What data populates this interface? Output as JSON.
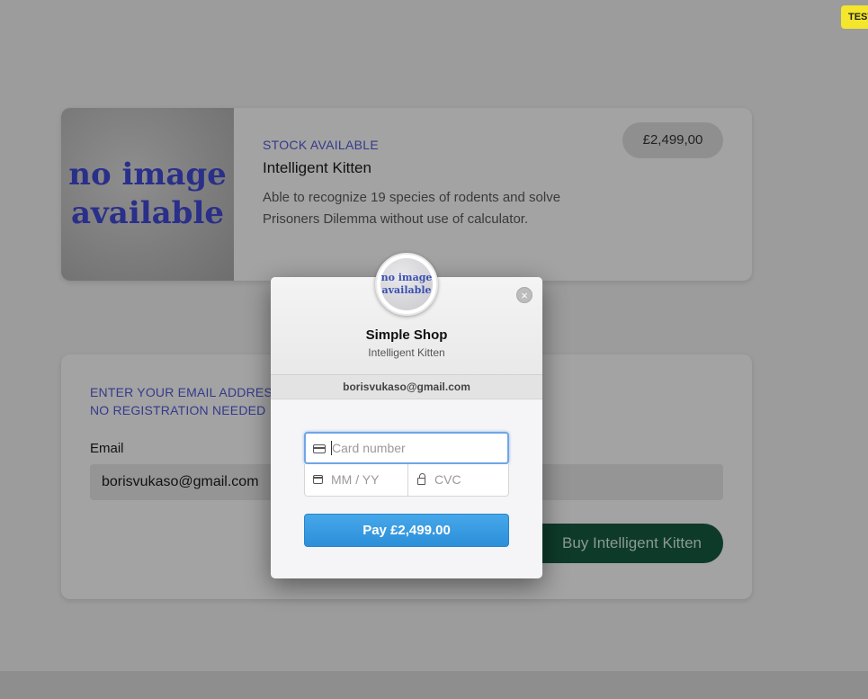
{
  "badge": {
    "label": "TEST"
  },
  "product": {
    "image_text": "no image available",
    "stock_status": "STOCK AVAILABLE",
    "name": "Intelligent Kitten",
    "description": "Able to recognize 19 species of rodents and solve Prisoners Dilemma without use of calculator.",
    "price": "£2,499,00"
  },
  "checkout_form": {
    "prompt_line1": "ENTER YOUR EMAIL ADDRESS",
    "prompt_line2": "NO REGISTRATION NEEDED",
    "email_label": "Email",
    "email_value": "borisvukaso@gmail.com",
    "buy_button_label": "Buy Intelligent Kitten"
  },
  "payment_modal": {
    "logo_text": "no image available",
    "close_icon": "×",
    "shop_name": "Simple Shop",
    "product_name": "Intelligent Kitten",
    "email": "borisvukaso@gmail.com",
    "card_number_placeholder": "Card number",
    "expiry_placeholder": "MM / YY",
    "cvc_placeholder": "CVC",
    "pay_button_label": "Pay £2,499.00"
  },
  "colors": {
    "accent_blue": "#2b8fd9",
    "buy_button": "#0e3a2a",
    "label_blue": "#343a8c",
    "test_badge": "#f3e62c"
  }
}
